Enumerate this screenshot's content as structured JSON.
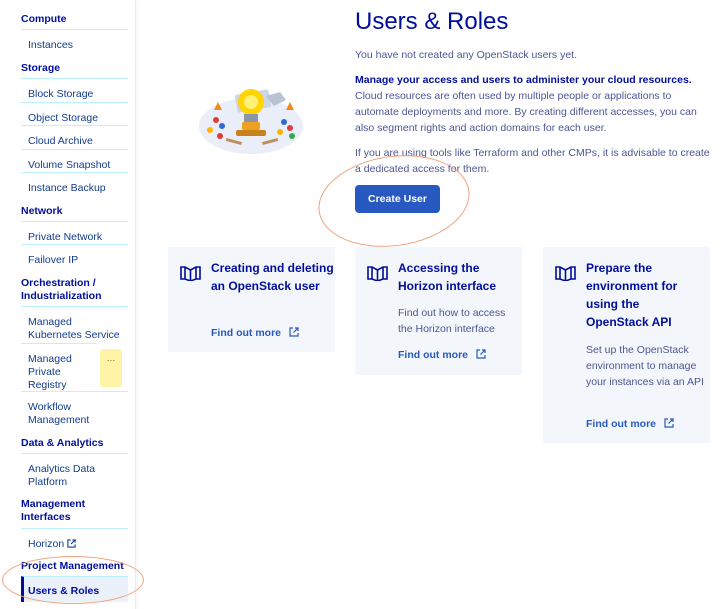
{
  "sidebar": {
    "sections": [
      {
        "title": "Compute",
        "items": [
          "Instances"
        ]
      },
      {
        "title": "Storage",
        "items": [
          "Block Storage",
          "Object Storage",
          "Cloud Archive",
          "Volume Snapshot",
          "Instance Backup"
        ]
      },
      {
        "title": "Network",
        "items": [
          "Private Network",
          "Failover IP"
        ]
      },
      {
        "title": "Orchestration / Industrialization",
        "items": [
          "Managed Kubernetes Service",
          "Managed Private Registry",
          "Workflow Management"
        ]
      },
      {
        "title": "Data & Analytics",
        "items": [
          "Analytics Data Platform"
        ]
      },
      {
        "title": "Management Interfaces",
        "items": [
          "Horizon"
        ]
      },
      {
        "title": "Project Management",
        "items": [
          "Users & Roles"
        ]
      }
    ],
    "note": "…"
  },
  "main": {
    "title": "Users & Roles",
    "empty_text": "You have not created any OpenStack users yet.",
    "heading": "Manage your access and users to administer your cloud resources.",
    "body": "Cloud resources are often used by multiple people or applications to automate deployments and more. By creating different accesses, you can also segment rights and action domains for each user.",
    "tip": "If you are using tools like Terraform and other CMPs, it is advisable to create a dedicated access for them.",
    "create_button": "Create User"
  },
  "cards": [
    {
      "title": "Creating and deleting an OpenStack user",
      "desc": "",
      "link": "Find out more"
    },
    {
      "title": "Accessing the Horizon interface",
      "desc": "Find out how to access the Horizon interface",
      "link": "Find out more"
    },
    {
      "title": "Prepare the environment for using the OpenStack API",
      "desc": "Set up the OpenStack environment to manage your instances via an API",
      "link": "Find out more"
    }
  ],
  "colors": {
    "primary": "#2859c0",
    "navy": "#000e9c",
    "card_bg": "#f3f6fa",
    "annotation": "#f0a27c"
  }
}
